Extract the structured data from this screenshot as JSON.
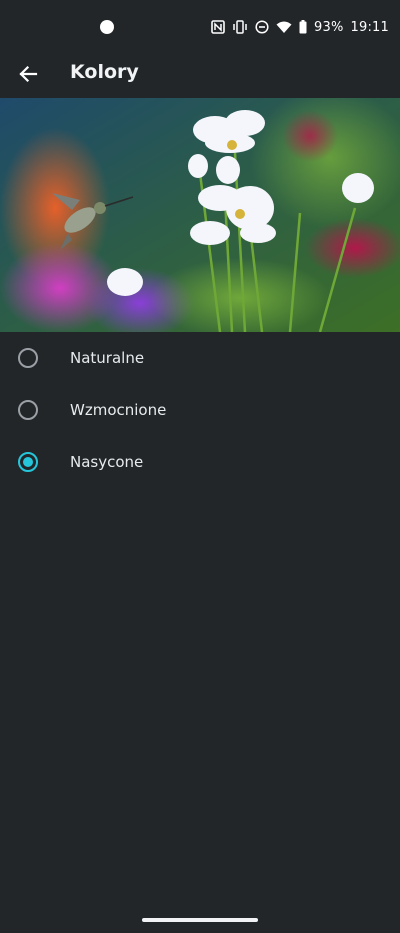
{
  "status_bar": {
    "battery_percent": "93%",
    "time": "19:11",
    "icons": [
      "nfc-icon",
      "vibrate-icon",
      "dnd-icon",
      "wifi-icon",
      "battery-icon"
    ]
  },
  "app_bar": {
    "title": "Kolory",
    "back_icon": "arrow-back-icon"
  },
  "preview": {
    "description_icon": "hummingbird-flowers-image"
  },
  "options": [
    {
      "label": "Naturalne",
      "checked": false
    },
    {
      "label": "Wzmocnione",
      "checked": false
    },
    {
      "label": "Nasycone",
      "checked": true
    }
  ],
  "colors": {
    "background": "#222629",
    "accent": "#26c6da"
  }
}
